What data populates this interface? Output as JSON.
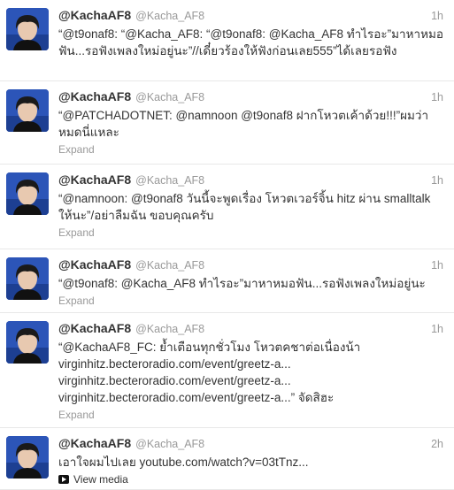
{
  "tweets": [
    {
      "fullname": "@KachaAF8",
      "username": "@Kacha_AF8",
      "time": "1h",
      "text": "“@t9onaf8: “@Kacha_AF8: “@t9onaf8: @Kacha_AF8 ทำไรอะ”มาหาหมอฟัน...รอฟังเพลงใหม่อยู่นะ”//เดี๋ยวร้องให้ฟังก่อนเลย555”ได้เลยรอฟัง",
      "action": ""
    },
    {
      "fullname": "@KachaAF8",
      "username": "@Kacha_AF8",
      "time": "1h",
      "text": "“@PATCHADOTNET: @namnoon @t9onaf8 ฝากโหวตเค้าด้วย!!!”ผมว่าหมดนี่แหละ",
      "action": "Expand"
    },
    {
      "fullname": "@KachaAF8",
      "username": "@Kacha_AF8",
      "time": "1h",
      "text": "“@namnoon: @t9onaf8 วันนี้จะพูดเรื่อง โหวตเวอร์จิ้น hitz ผ่าน smalltalk ให้นะ”/อย่าลืมฉัน ขอบคุณครับ",
      "action": "Expand"
    },
    {
      "fullname": "@KachaAF8",
      "username": "@Kacha_AF8",
      "time": "1h",
      "text": "“@t9onaf8: @Kacha_AF8 ทำไรอะ”มาหาหมอฟัน...รอฟังเพลงใหม่อยู่นะ",
      "action": "Expand"
    },
    {
      "fullname": "@KachaAF8",
      "username": "@Kacha_AF8",
      "time": "1h",
      "text": "“@KachaAF8_FC: ย้ำเตือนทุกชั่วโมง โหวตคชาต่อเนื่องน้า virginhitz.becteroradio.com/event/greetz-a... virginhitz.becteroradio.com/event/greetz-a... virginhitz.becteroradio.com/event/greetz-a...” จัดสิฮะ",
      "action": "Expand"
    },
    {
      "fullname": "@KachaAF8",
      "username": "@Kacha_AF8",
      "time": "2h",
      "text": "เอาใจผมไปเลย youtube.com/watch?v=03tTnz...",
      "action": "View media"
    }
  ]
}
